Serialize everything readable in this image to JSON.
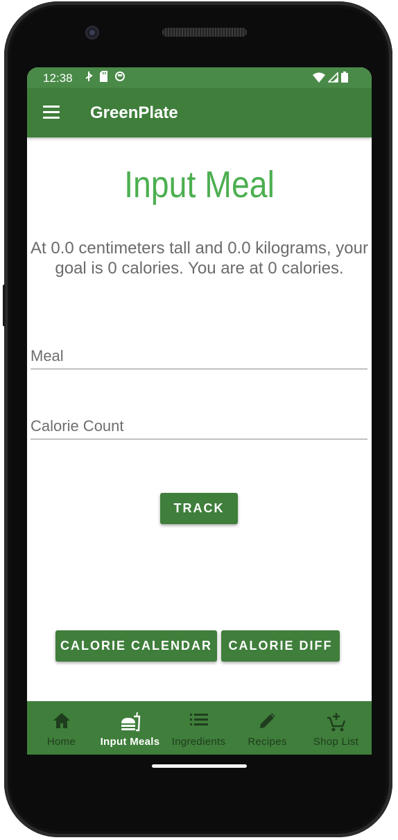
{
  "status_bar": {
    "time": "12:38"
  },
  "app_bar": {
    "title": "GreenPlate",
    "menu_icon": "menu-icon"
  },
  "main": {
    "heading": "Input Meal",
    "goal_text": "At 0.0 centimeters tall and 0.0 kilograms, your goal is 0 calories. You are at 0 calories.",
    "meal_field": {
      "value": "",
      "placeholder": "Meal"
    },
    "calorie_field": {
      "value": "",
      "placeholder": "Calorie Count"
    },
    "track_button": "TRACK",
    "calendar_button": "CALORIE CALENDAR",
    "diff_button": "CALORIE DIFF"
  },
  "bottom_nav": {
    "items": [
      {
        "label": "Home",
        "icon": "home-icon",
        "active": false
      },
      {
        "label": "Input Meals",
        "icon": "fastfood-icon",
        "active": true
      },
      {
        "label": "Ingredients",
        "icon": "list-icon",
        "active": false
      },
      {
        "label": "Recipes",
        "icon": "pencil-icon",
        "active": false
      },
      {
        "label": "Shop List",
        "icon": "add-cart-icon",
        "active": false
      }
    ]
  },
  "colors": {
    "primary": "#3f7e3b",
    "status_bar": "#4a8a48",
    "heading": "#4caf50",
    "nav_inactive": "#1f3d1d"
  }
}
